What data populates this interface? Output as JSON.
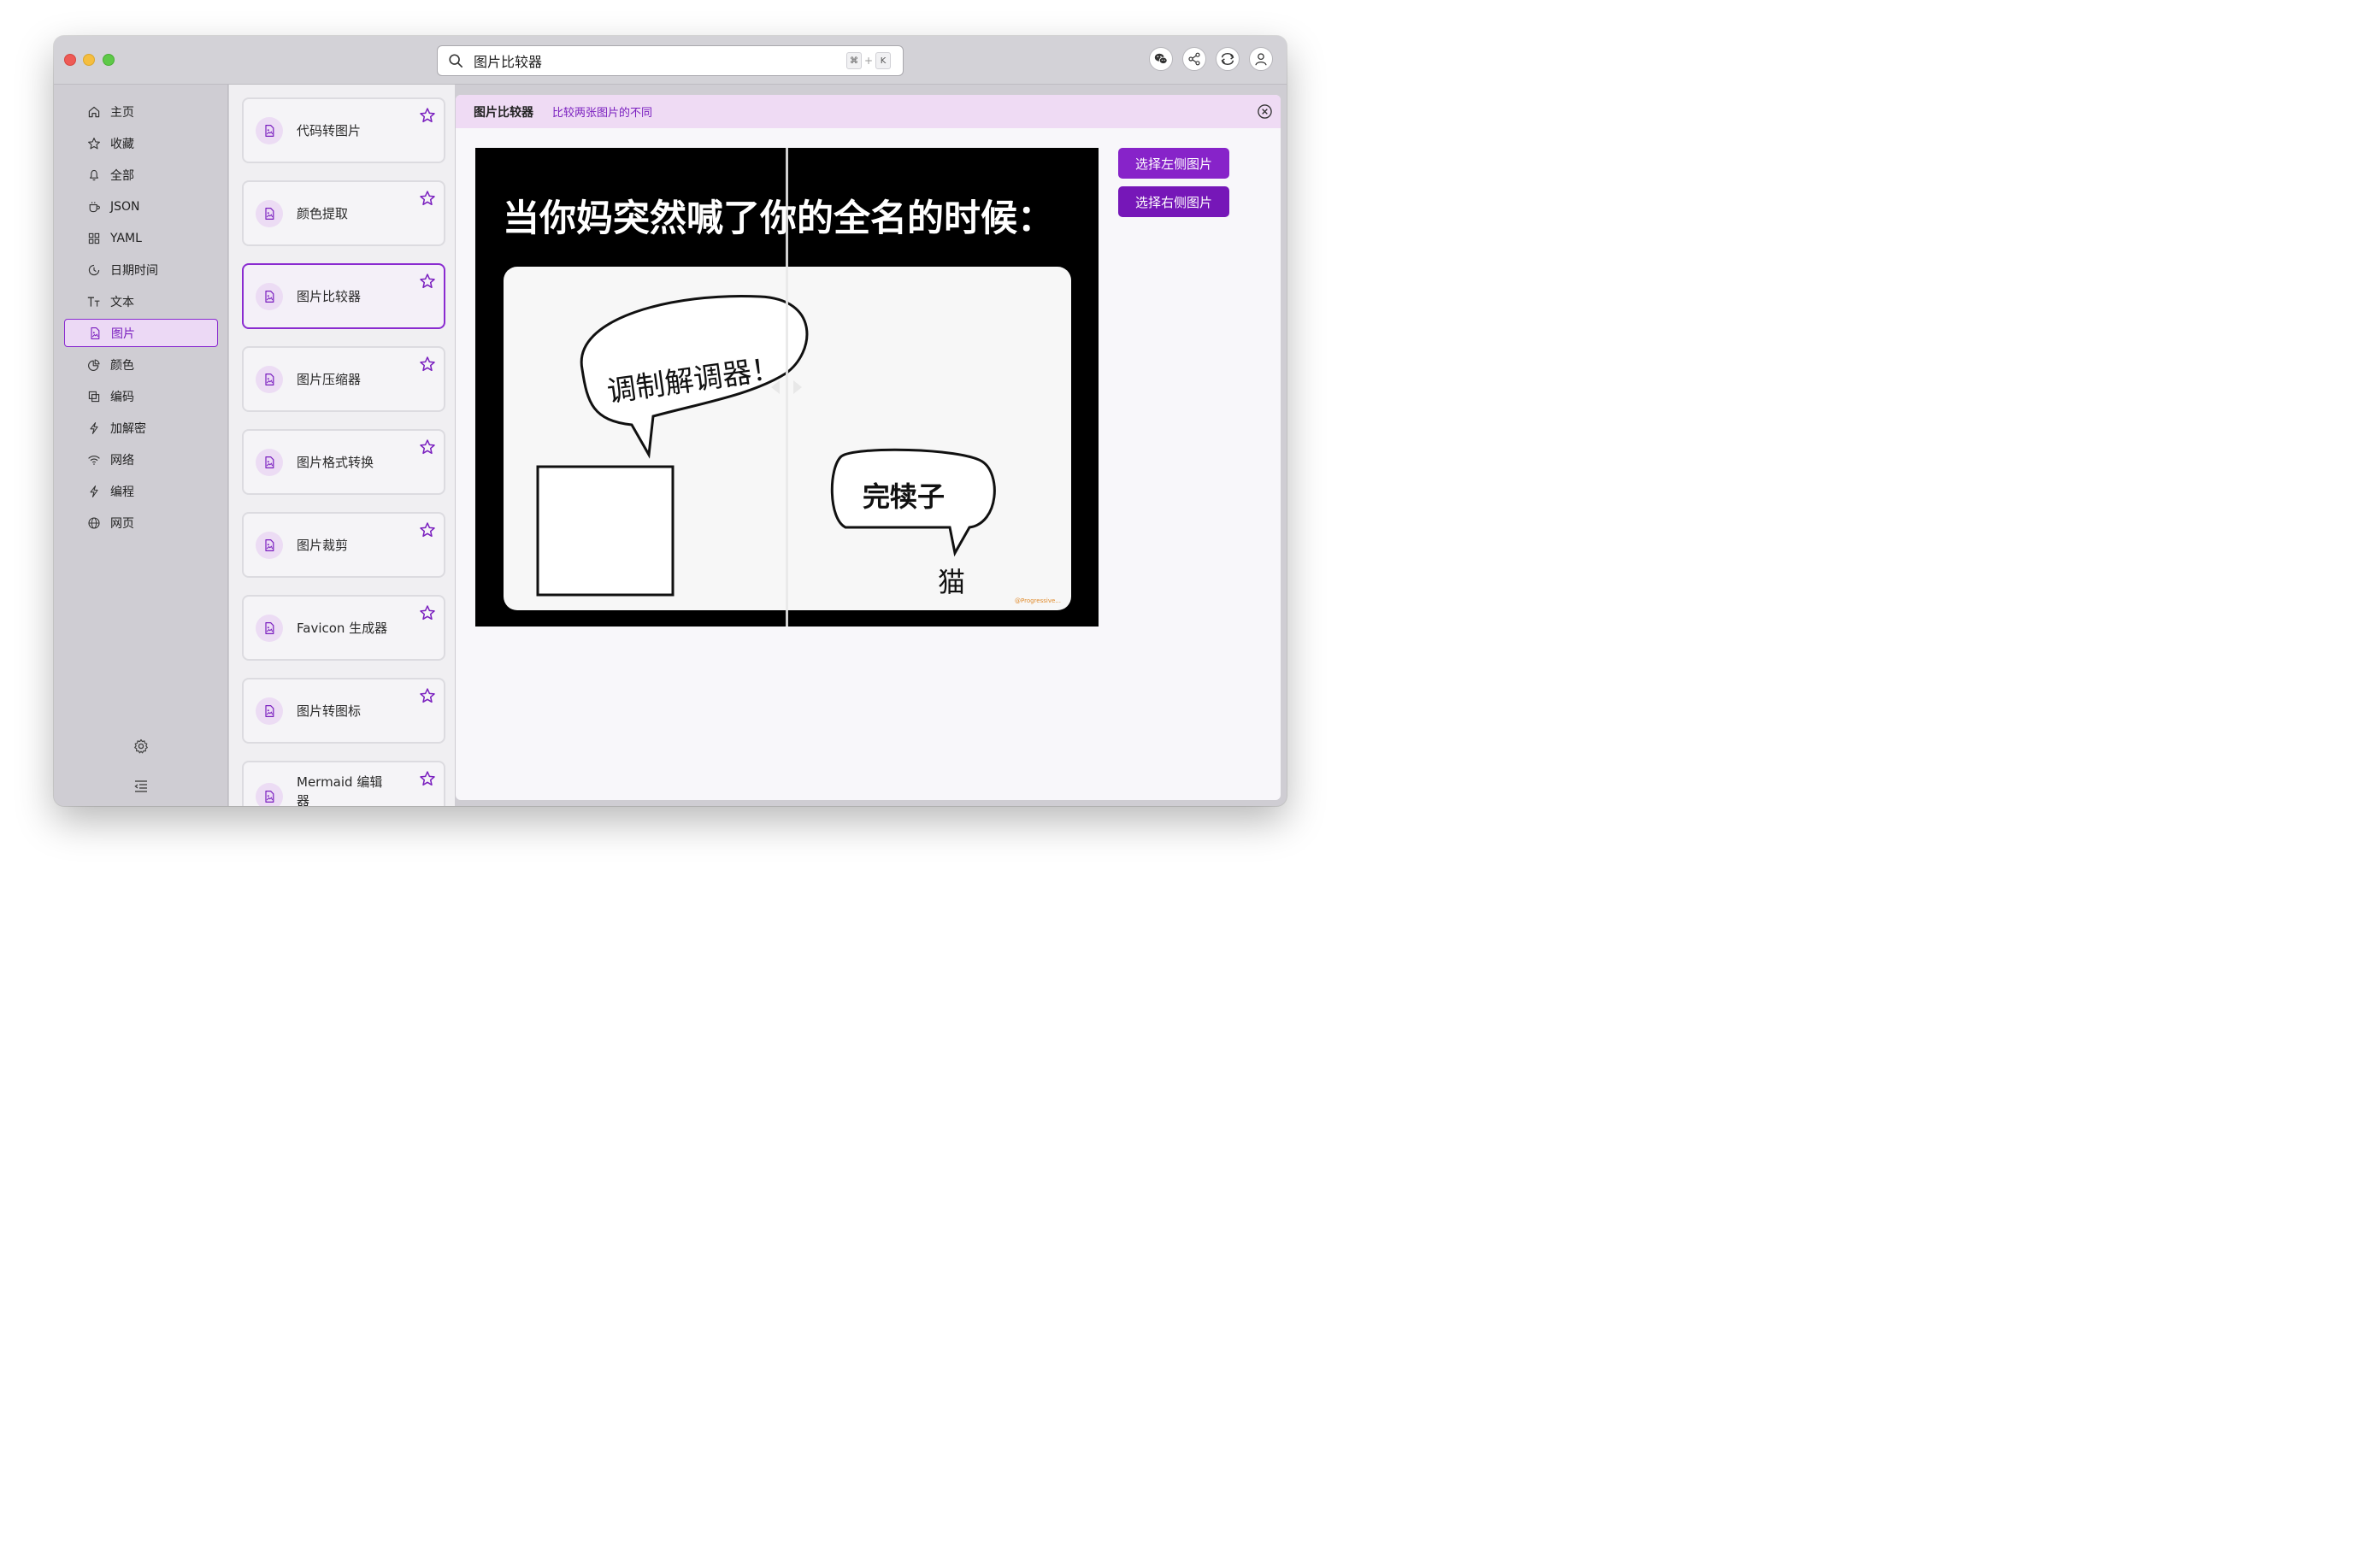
{
  "search": {
    "value": "图片比较器",
    "shortcut_cmd": "⌘",
    "shortcut_plus": "+",
    "shortcut_key": "K"
  },
  "topbar": {
    "icons": [
      "wechat-icon",
      "share-icon",
      "sync-icon",
      "user-icon"
    ]
  },
  "sidebar": {
    "items": [
      {
        "label": "主页",
        "icon": "home-icon"
      },
      {
        "label": "收藏",
        "icon": "star-icon"
      },
      {
        "label": "全部",
        "icon": "bell-icon"
      },
      {
        "label": "JSON",
        "icon": "cup-icon"
      },
      {
        "label": "YAML",
        "icon": "grid-icon"
      },
      {
        "label": "日期时间",
        "icon": "clock-icon"
      },
      {
        "label": "文本",
        "icon": "text-icon"
      },
      {
        "label": "图片",
        "icon": "image-file-icon",
        "active": true
      },
      {
        "label": "颜色",
        "icon": "pie-icon"
      },
      {
        "label": "编码",
        "icon": "copy-icon"
      },
      {
        "label": "加解密",
        "icon": "bolt-icon"
      },
      {
        "label": "网络",
        "icon": "wifi-icon"
      },
      {
        "label": "编程",
        "icon": "bolt-icon"
      },
      {
        "label": "网页",
        "icon": "globe-icon"
      }
    ],
    "bottom_icons": [
      "settings-icon",
      "collapse-icon"
    ]
  },
  "tools": [
    {
      "name": "代码转图片"
    },
    {
      "name": "颜色提取"
    },
    {
      "name": "图片比较器",
      "active": true
    },
    {
      "name": "图片压缩器"
    },
    {
      "name": "图片格式转换"
    },
    {
      "name": "图片裁剪"
    },
    {
      "name": "Favicon 生成器"
    },
    {
      "name": "图片转图标"
    },
    {
      "name": "Mermaid 编辑器"
    }
  ],
  "main": {
    "title": "图片比较器",
    "subtitle": "比较两张图片的不同",
    "btn_left": "选择左侧图片",
    "btn_right": "选择右侧图片"
  },
  "meme": {
    "headline": "当你妈突然喊了你的全名的时候：",
    "bubble1": "调制解调器！",
    "bubble2": "完犊子",
    "caption": "猫",
    "watermark": "@Progressive..."
  },
  "colors": {
    "accent": "#8723c9",
    "accent_bg": "#efdbf4"
  }
}
